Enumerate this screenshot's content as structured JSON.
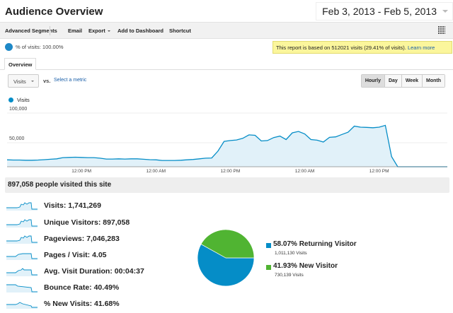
{
  "header": {
    "title": "Audience Overview",
    "date_range": "Feb 3, 2013 - Feb 5, 2013"
  },
  "toolbar": {
    "advanced_segments": "Advanced Segments",
    "email": "Email",
    "export": "Export",
    "add_to_dashboard": "Add to Dashboard",
    "shortcut": "Shortcut"
  },
  "segment": {
    "text": "% of visits: 100.00%"
  },
  "notice": {
    "text": "This report is based on 512021 visits (29.41% of visits).",
    "link": "Learn more"
  },
  "tabs": [
    "Overview"
  ],
  "controls": {
    "metric": "Visits",
    "vs": "vs.",
    "select_metric": "Select a metric",
    "periods": [
      "Hourly",
      "Day",
      "Week",
      "Month"
    ],
    "active_period": "Hourly"
  },
  "colors": {
    "series": "#058dc7",
    "fill": "#e1f1f9",
    "returning": "#058dc7",
    "new": "#50b432",
    "notice_bg": "#fbf69c"
  },
  "chart_data": {
    "type": "area",
    "title": "",
    "series": [
      {
        "name": "Visits",
        "values": [
          12850,
          12500,
          12500,
          12100,
          12100,
          12500,
          13200,
          14000,
          14700,
          17000,
          17400,
          17800,
          17400,
          17000,
          17000,
          15900,
          14400,
          14400,
          14700,
          14400,
          14700,
          14700,
          14000,
          13200,
          12900,
          11700,
          11700,
          11700,
          12100,
          12900,
          13600,
          14700,
          15900,
          16300,
          29100,
          47300,
          48800,
          49900,
          52900,
          59300,
          58600,
          48000,
          48800,
          54400,
          57100,
          50700,
          63100,
          65800,
          61200,
          50700,
          49500,
          46100,
          54800,
          55600,
          60100,
          64300,
          75600,
          73700,
          73300,
          72600,
          73700,
          77100,
          18900,
          0,
          0,
          0,
          0,
          0,
          0,
          0,
          0,
          0
        ]
      }
    ],
    "x_range": [
      "Feb 3, 2013 12:00 AM",
      "Feb 5, 2013 11:00 PM"
    ],
    "x_tick_labels": [
      "12:00 PM",
      "12:00 AM",
      "12:00 PM",
      "12:00 AM",
      "12:00 PM"
    ],
    "y_tick_labels": [
      "100,000",
      "50,000"
    ],
    "ylim": [
      0,
      100000
    ],
    "grid": true,
    "legend": "top-left"
  },
  "summary": {
    "text": "897,058 people visited this site"
  },
  "metrics": [
    {
      "label": "Visits: 1,741,269"
    },
    {
      "label": "Unique Visitors: 897,058"
    },
    {
      "label": "Pageviews: 7,046,283"
    },
    {
      "label": "Pages / Visit: 4.05"
    },
    {
      "label": "Avg. Visit Duration: 00:04:37"
    },
    {
      "label": "Bounce Rate: 40.49%"
    },
    {
      "label": "% New Visits: 41.68%"
    }
  ],
  "pie": {
    "type": "pie",
    "slices": [
      {
        "pct": "58.07%",
        "label": "Returning Visitor",
        "value": 58.07,
        "visits": "1,011,130 Visits"
      },
      {
        "pct": "41.93%",
        "label": "New Visitor",
        "value": 41.93,
        "visits": "730,139 Visits"
      }
    ]
  }
}
